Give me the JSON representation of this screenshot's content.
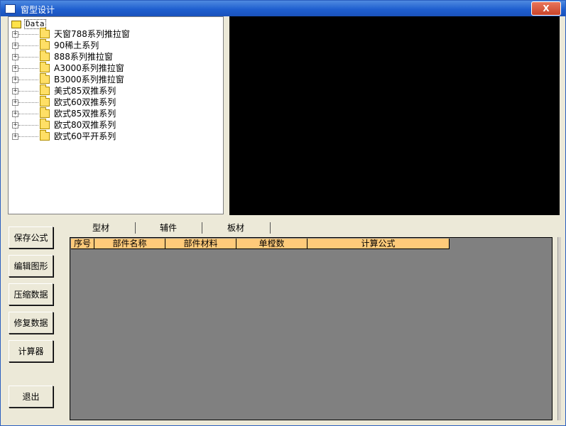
{
  "window": {
    "title": "窗型设计",
    "close_label": "X"
  },
  "tree": {
    "root_label": "Data",
    "nodes": [
      "天窗788系列推拉窗",
      "90稀土系列",
      "888系列推拉窗",
      "A3000系列推拉窗",
      "B3000系列推拉窗",
      "美式85双推系列",
      "欧式60双推系列",
      "欧式85双推系列",
      "欧式80双推系列",
      "欧式60平开系列"
    ]
  },
  "buttons": {
    "save_formula": "保存公式",
    "edit_shape": "编辑图形",
    "compress_data": "压缩数据",
    "repair_data": "修复数据",
    "calculator": "计算器",
    "exit": "退出"
  },
  "tabs": [
    "型材",
    "辅件",
    "板材"
  ],
  "table": {
    "columns": [
      "序号",
      "部件名称",
      "部件材料",
      "单樘数",
      "计算公式"
    ]
  }
}
